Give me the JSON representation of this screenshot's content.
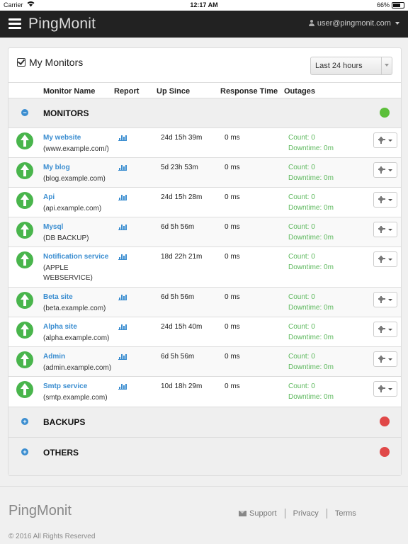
{
  "statusbar": {
    "carrier": "Carrier",
    "time": "12:17 AM",
    "battery": "66%"
  },
  "navbar": {
    "brand": "PingMonit",
    "user": "user@pingmonit.com"
  },
  "panel": {
    "title": "My Monitors",
    "range": "Last 24 hours"
  },
  "columns": {
    "name": "Monitor Name",
    "report": "Report",
    "upsince": "Up Since",
    "response": "Response Time",
    "outages": "Outages"
  },
  "groups": {
    "monitors": {
      "label": "MONITORS",
      "toggle": "−",
      "status_color": "#5cbf3a"
    },
    "backups": {
      "label": "BACKUPS",
      "toggle": "+",
      "status_color": "#e04848"
    },
    "others": {
      "label": "OTHERS",
      "toggle": "+",
      "status_color": "#e04848"
    }
  },
  "monitors": [
    {
      "name": "My website",
      "url": "(www.example.com/)",
      "upsince": "24d 15h 39m",
      "response": "0 ms",
      "count": "Count: 0",
      "downtime": "Downtime: 0m"
    },
    {
      "name": "My blog",
      "url": "(blog.example.com)",
      "upsince": "5d 23h 53m",
      "response": "0 ms",
      "count": "Count: 0",
      "downtime": "Downtime: 0m"
    },
    {
      "name": "Api",
      "url": "(api.example.com)",
      "upsince": "24d 15h 28m",
      "response": "0 ms",
      "count": "Count: 0",
      "downtime": "Downtime: 0m"
    },
    {
      "name": "Mysql",
      "url": "(DB BACKUP)",
      "upsince": "6d 5h 56m",
      "response": "0 ms",
      "count": "Count: 0",
      "downtime": "Downtime: 0m"
    },
    {
      "name": "Notification service",
      "url": "(APPLE WEBSERVICE)",
      "upsince": "18d 22h 21m",
      "response": "0 ms",
      "count": "Count: 0",
      "downtime": "Downtime: 0m"
    },
    {
      "name": "Beta site",
      "url": "(beta.example.com)",
      "upsince": "6d 5h 56m",
      "response": "0 ms",
      "count": "Count: 0",
      "downtime": "Downtime: 0m"
    },
    {
      "name": "Alpha site",
      "url": "(alpha.example.com)",
      "upsince": "24d 15h 40m",
      "response": "0 ms",
      "count": "Count: 0",
      "downtime": "Downtime: 0m"
    },
    {
      "name": "Admin",
      "url": "(admin.example.com)",
      "upsince": "6d 5h 56m",
      "response": "0 ms",
      "count": "Count: 0",
      "downtime": "Downtime: 0m"
    },
    {
      "name": "Smtp service",
      "url": "(smtp.example.com)",
      "upsince": "10d 18h 29m",
      "response": "0 ms",
      "count": "Count: 0",
      "downtime": "Downtime: 0m"
    }
  ],
  "footer": {
    "brand": "PingMonit",
    "support": "Support",
    "privacy": "Privacy",
    "terms": "Terms",
    "copyright": "© 2016 All Rights Reserved"
  }
}
